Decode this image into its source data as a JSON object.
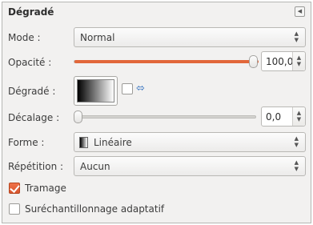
{
  "panel": {
    "title": "Dégradé",
    "menu_icon": "panel-menu-icon"
  },
  "mode": {
    "label": "Mode :",
    "value": "Normal"
  },
  "opacity": {
    "label": "Opacité :",
    "value": "100,0",
    "fraction": 1.0
  },
  "gradient": {
    "label": "Dégradé :",
    "reverse_checked": false,
    "swap_icon": "swap-arrows-icon"
  },
  "offset": {
    "label": "Décalage :",
    "value": "0,0",
    "fraction": 0.0
  },
  "shape": {
    "label": "Forme :",
    "value": "Linéaire"
  },
  "repeat": {
    "label": "Répétition :",
    "value": "Aucun"
  },
  "dither": {
    "label": "Tramage",
    "checked": true
  },
  "supersample": {
    "label": "Suréchantillonnage adaptatif",
    "checked": false
  },
  "colors": {
    "accent": "#e2673a",
    "panel_bg": "#f2f1f0"
  }
}
